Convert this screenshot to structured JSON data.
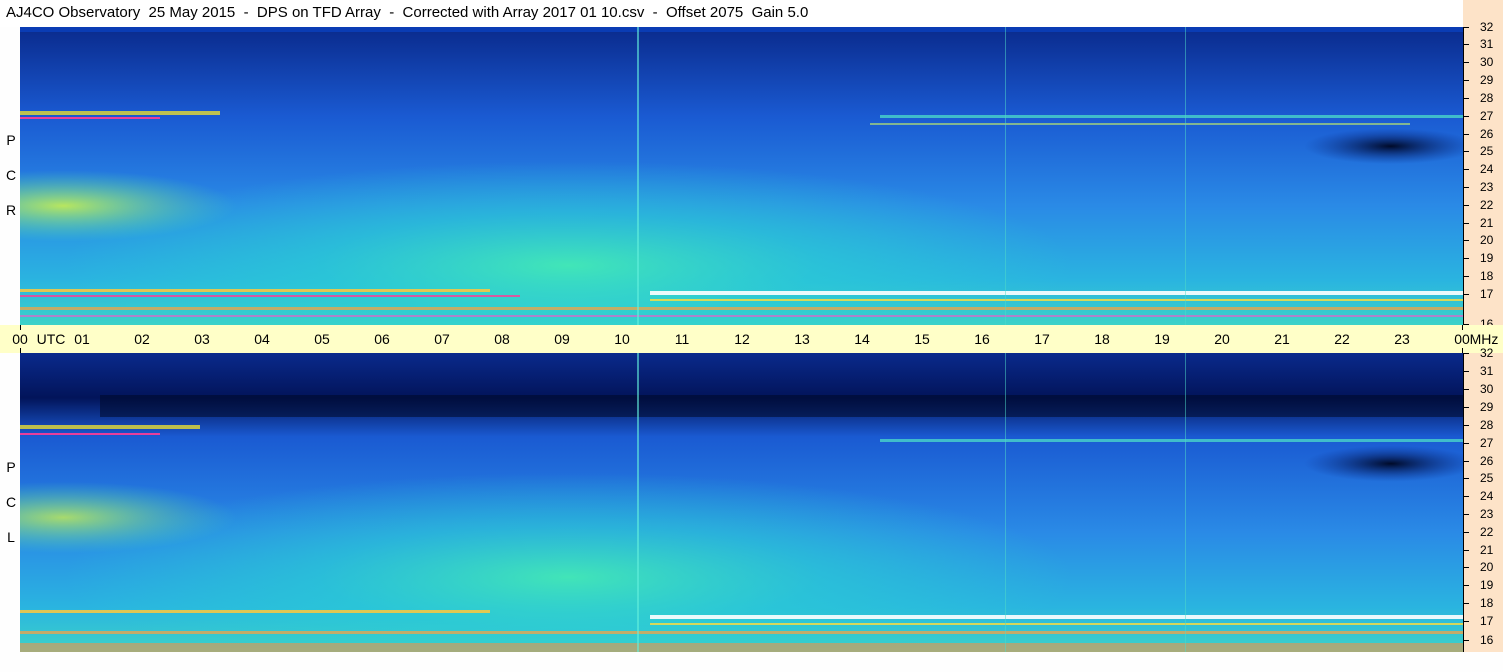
{
  "title": "AJ4CO Observatory  25 May 2015  -  DPS on TFD Array  -  Corrected with Array 2017 01 10.csv  -  Offset 2075  Gain 5.0",
  "time_axis": {
    "labels": [
      "00",
      "UTC",
      "01",
      "02",
      "03",
      "04",
      "05",
      "06",
      "07",
      "08",
      "09",
      "10",
      "11",
      "12",
      "13",
      "14",
      "15",
      "16",
      "17",
      "18",
      "19",
      "20",
      "21",
      "22",
      "23",
      "00",
      "MHz"
    ]
  },
  "panels": [
    {
      "id": "top",
      "polarization_letters": [
        "P",
        "C",
        "R"
      ],
      "freq_labels": [
        "32",
        "31",
        "30",
        "29",
        "28",
        "27",
        "26",
        "25",
        "24",
        "23",
        "22",
        "21",
        "20",
        "19",
        "18",
        "17",
        "16"
      ]
    },
    {
      "id": "bottom",
      "polarization_letters": [
        "P",
        "C",
        "L"
      ],
      "freq_labels": [
        "32",
        "31",
        "30",
        "29",
        "28",
        "27",
        "26",
        "25",
        "24",
        "23",
        "22",
        "21",
        "20",
        "19",
        "18",
        "17",
        "16"
      ]
    }
  ],
  "colors": {
    "freq_axis_bg": "#fde3c8",
    "time_axis_bg": "#ffffc8",
    "spectrogram_deep": "#02145a",
    "spectrogram_blue": "#1a5ad2",
    "spectrogram_cyan": "#28c8e6",
    "spectrogram_green": "#3ce6b4"
  }
}
